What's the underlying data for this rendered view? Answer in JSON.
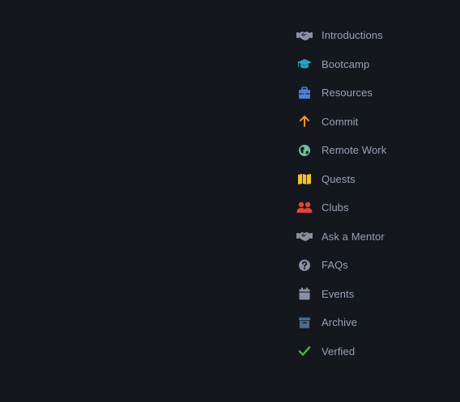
{
  "nav": {
    "items": [
      {
        "label": "Introductions",
        "icon": "handshake-icon",
        "color": "#8a90a6"
      },
      {
        "label": "Bootcamp",
        "icon": "graduation-cap-icon",
        "color": "#29a3c2"
      },
      {
        "label": "Resources",
        "icon": "toolbox-icon",
        "color": "#4d7fd6"
      },
      {
        "label": "Commit",
        "icon": "arrow-up-icon",
        "color": "#f0952c"
      },
      {
        "label": "Remote Work",
        "icon": "globe-icon",
        "color": "#6fc29a"
      },
      {
        "label": "Quests",
        "icon": "map-icon",
        "color": "#f2c12e"
      },
      {
        "label": "Clubs",
        "icon": "users-icon",
        "color": "#e0463a"
      },
      {
        "label": "Ask a Mentor",
        "icon": "handshake-icon",
        "color": "#8a8f9c"
      },
      {
        "label": "FAQs",
        "icon": "question-circle-icon",
        "color": "#8a90a6"
      },
      {
        "label": "Events",
        "icon": "calendar-icon",
        "color": "#8a90a6"
      },
      {
        "label": "Archive",
        "icon": "archive-box-icon",
        "color": "#4d6a8a"
      },
      {
        "label": "Verfied",
        "icon": "checkmark-icon",
        "color": "#4caf2e"
      }
    ]
  }
}
